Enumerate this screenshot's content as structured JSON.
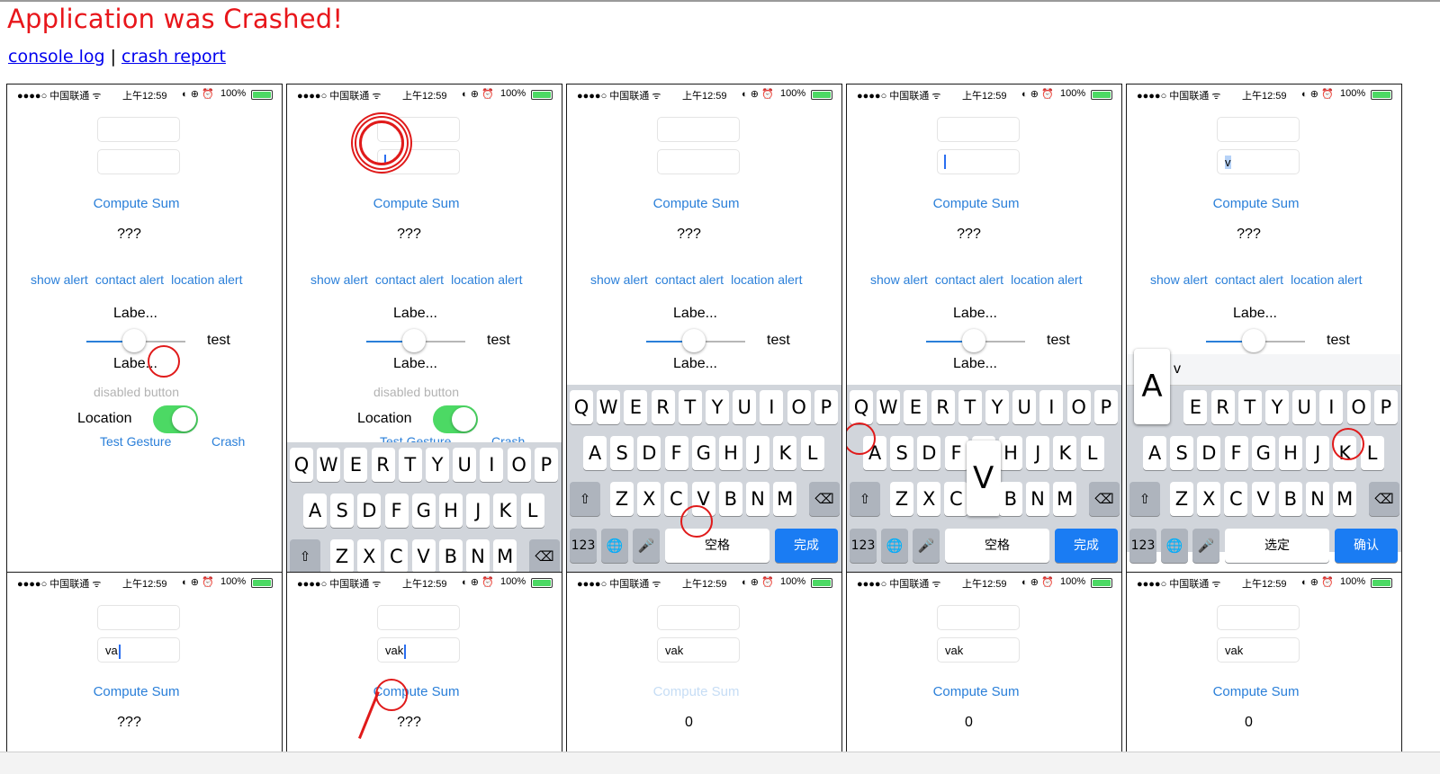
{
  "header": {
    "title": "Application was Crashed!",
    "console_log_link": "console log",
    "separator": "|",
    "crash_report_link": "crash report"
  },
  "status": {
    "carrier": "●●●●○ 中国联通 ᯤ",
    "time": "上午12:59",
    "icons": "◐ ⊕ ⏰",
    "battery": "100%"
  },
  "app": {
    "compute_label": "Compute Sum",
    "result_initial": "???",
    "result_after": "0",
    "show_alert": "show alert",
    "contact_alert": "contact alert",
    "location_alert": "location alert",
    "label_text": "Labe...",
    "test_label": "test",
    "disabled_button": "disabled button",
    "location_label": "Location",
    "test_gesture": "Test Gesture",
    "crash_label": "Crash",
    "input_v": "v",
    "input_va": "va",
    "input_vak": "vak"
  },
  "keyboard": {
    "row1": [
      "Q",
      "W",
      "E",
      "R",
      "T",
      "Y",
      "U",
      "I",
      "O",
      "P"
    ],
    "row2": [
      "A",
      "S",
      "D",
      "F",
      "G",
      "H",
      "J",
      "K",
      "L"
    ],
    "row3": [
      "Z",
      "X",
      "C",
      "V",
      "B",
      "N",
      "M"
    ],
    "shift_icon": "⇧",
    "delete_icon": "⌫",
    "numbers_key": "123",
    "globe_icon": "🌐",
    "mic_icon": "🎤",
    "space_label": "空格",
    "done_label": "完成",
    "select_label": "选定",
    "confirm_label": "确认",
    "popup_v": "V",
    "popup_a": "A",
    "suggestions": [
      "v",
      "v"
    ]
  }
}
